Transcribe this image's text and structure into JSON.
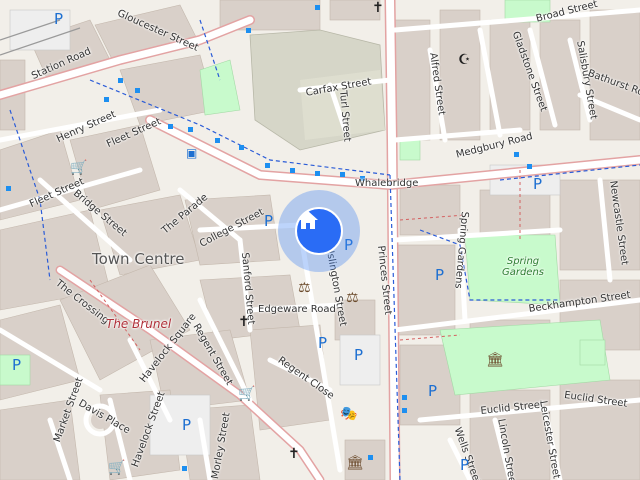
{
  "map": {
    "area_label": "Town Centre",
    "landmark_label": "The Brunel",
    "park_label": "Spring Gardens",
    "colors": {
      "background": "#f2efe9",
      "building": "#d9d0c9",
      "road": "#ffffff",
      "main_road_casing": "#e3a3a3",
      "park": "#c8facc",
      "parking": "#1d6fd1",
      "location": "#2a6cf5"
    },
    "streets": [
      "Gloucester Street",
      "Station Road",
      "Henry Street",
      "Fleet Street",
      "Fleet Street",
      "Bridge Street",
      "The Parade",
      "College Street",
      "Carfax Street",
      "Turl Street",
      "Whalebridge",
      "Broad Street",
      "Gladstone Street",
      "Salisbury Street",
      "Bathurst Road",
      "Alfred Street",
      "Medgbury Road",
      "Newcastle Street",
      "Spring Gardens",
      "Princes Street",
      "Islington Street",
      "Sanford Street",
      "Edgeware Road",
      "The Crossing",
      "Havelock Square",
      "Regent Street",
      "Regent Close",
      "Beckhampton Street",
      "Euclid Street",
      "Euclid Street",
      "Leicester Street",
      "Lincoln Street",
      "Wells Street",
      "Market Street",
      "Havelock Street",
      "Morley Street",
      "Davis Place"
    ],
    "parking_symbol": "P",
    "icons": [
      "home-icon",
      "church-icon",
      "mosque-icon",
      "court-icon",
      "museum-icon",
      "theatre-icon",
      "shop-icon",
      "bus-icon",
      "parking-icon"
    ]
  }
}
